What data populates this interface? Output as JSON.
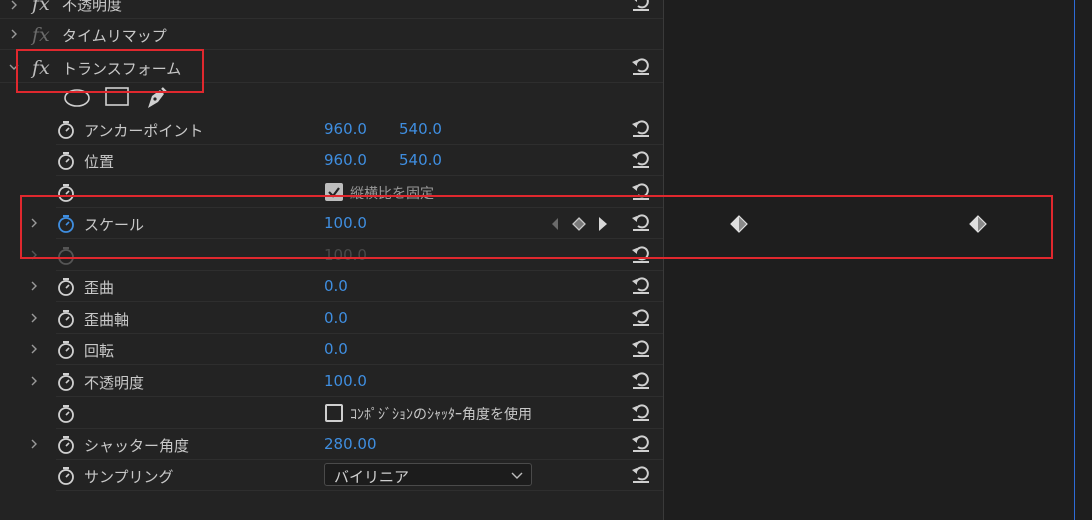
{
  "colors": {
    "accent_blue": "#3f8ee0",
    "highlight_red": "#e0282e",
    "panel_bg": "#232323",
    "timeline_bg": "#1e1e1e"
  },
  "effects": {
    "opacity_effect": {
      "label": "不透明度",
      "icon": "fx-icon"
    },
    "time_remap": {
      "label": "タイムリマップ",
      "icon": "fx-icon"
    },
    "transform": {
      "label": "トランスフォーム",
      "icon": "fx-icon"
    }
  },
  "mask_tools": [
    "ellipse-mask-icon",
    "rectangle-mask-icon",
    "pen-mask-icon"
  ],
  "properties": {
    "anchor": {
      "label": "アンカーポイント",
      "x": "960.0",
      "y": "540.0"
    },
    "position": {
      "label": "位置",
      "x": "960.0",
      "y": "540.0"
    },
    "uniform_scale": {
      "label": "縦横比を固定",
      "checked": true
    },
    "scale": {
      "label": "スケール",
      "value": "100.0"
    },
    "scale_width": {
      "value": "100.0"
    },
    "skew": {
      "label": "歪曲",
      "value": "0.0"
    },
    "skew_axis": {
      "label": "歪曲軸",
      "value": "0.0"
    },
    "rotation": {
      "label": "回転",
      "value": "0.0"
    },
    "opacity": {
      "label": "不透明度",
      "value": "100.0"
    },
    "comp_shutter": {
      "label": "ｺﾝﾎﾟｼﾞｼｮﾝのｼｬｯﾀｰ角度を使用",
      "checked": false
    },
    "shutter_angle": {
      "label": "シャッター角度",
      "value": "280.00"
    },
    "sampling": {
      "label": "サンプリング",
      "value": "バイリニア"
    }
  },
  "icons": [
    "chevron-right-icon",
    "chevron-down-icon",
    "stopwatch-icon",
    "reset-icon",
    "keyframe-icon",
    "prev-keyframe-icon",
    "next-keyframe-icon"
  ]
}
